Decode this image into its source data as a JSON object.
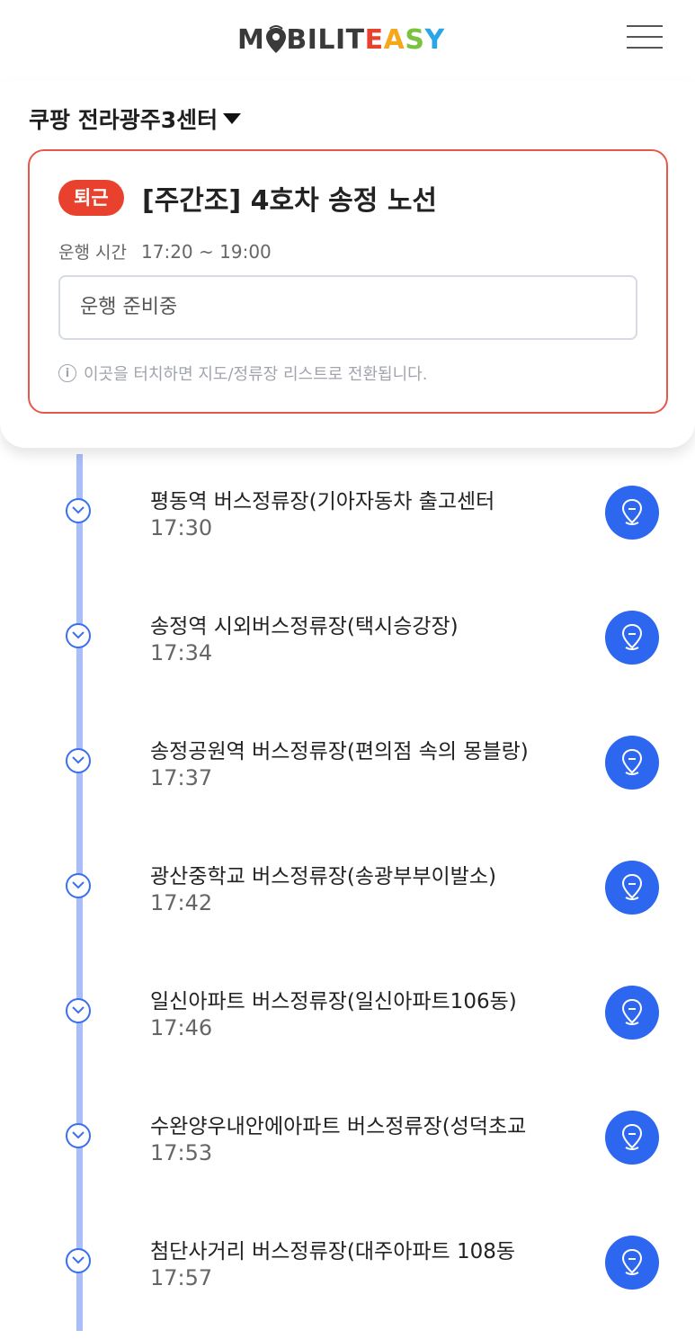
{
  "header": {
    "logo": {
      "part1": "M",
      "part2": "BILIT",
      "e": "E",
      "a": "A",
      "s": "S",
      "y": "Y"
    },
    "menu_icon": "hamburger-icon"
  },
  "center": {
    "name": "쿠팡 전라광주3센터"
  },
  "route": {
    "badge": "퇴근",
    "title": "[주간조] 4호차 송정 노선",
    "time_label": "운행 시간",
    "time_value": "17:20 ~ 19:00",
    "status": "운행 준비중",
    "hint": "이곳을 터치하면 지도/정류장 리스트로 전환됩니다.",
    "hint_icon": "i"
  },
  "stops": [
    {
      "name": "평동역 버스정류장(기아자동차 출고센터",
      "time": "17:30"
    },
    {
      "name": "송정역 시외버스정류장(택시승강장)",
      "time": "17:34"
    },
    {
      "name": "송정공원역 버스정류장(편의점 속의 몽블랑)",
      "time": "17:37"
    },
    {
      "name": "광산중학교 버스정류장(송광부부이발소)",
      "time": "17:42"
    },
    {
      "name": "일신아파트 버스정류장(일신아파트106동)",
      "time": "17:46"
    },
    {
      "name": "수완양우내안에아파트 버스정류장(성덕초교",
      "time": "17:53"
    },
    {
      "name": " 첨단사거리 버스정류장(대주아파트 108동",
      "time": "17:57"
    }
  ],
  "colors": {
    "accent": "#2d67f0",
    "badge": "#e8412d",
    "timeline": "#a9bdfa",
    "card_border": "#e8584a"
  }
}
